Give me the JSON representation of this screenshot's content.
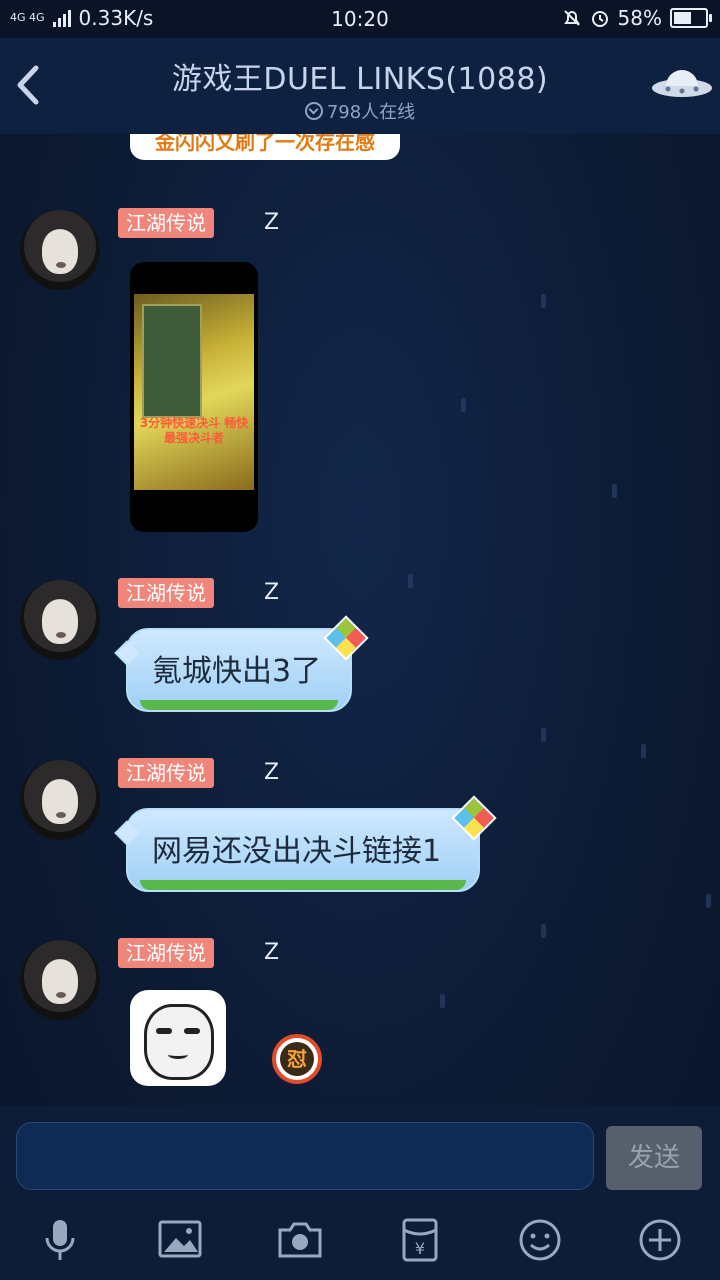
{
  "status_bar": {
    "network_tag": "4G 4G",
    "speed": "0.33K/s",
    "time": "10:20",
    "battery": "58%",
    "battery_level": 0.58,
    "icons": [
      "signal-icon",
      "mute-bell-icon",
      "alarm-icon",
      "battery-icon"
    ]
  },
  "header": {
    "title": "游戏王DUEL LINKS(1088)",
    "online": "798人在线",
    "icons": [
      "back-arrow-icon",
      "ufo-icon",
      "online-check-icon"
    ]
  },
  "chat": {
    "partial_message": "金闪闪又刷了一次存在感",
    "messages": [
      {
        "badge": "江湖传说",
        "name": "Z",
        "type": "image",
        "image_text": "3分钟快速决斗 畅快最强决斗者"
      },
      {
        "badge": "江湖传说",
        "name": "Z",
        "type": "text",
        "text": "氪城快出3了"
      },
      {
        "badge": "江湖传说",
        "name": "Z",
        "type": "text",
        "text": "网易还没出决斗链接1"
      },
      {
        "badge": "江湖传说",
        "name": "Z",
        "type": "sticker",
        "emoji_text": "怼"
      }
    ]
  },
  "input": {
    "placeholder": "",
    "send_label": "发送"
  },
  "toolbar": {
    "items": [
      "microphone-icon",
      "image-icon",
      "camera-icon",
      "red-packet-icon",
      "emoji-icon",
      "plus-icon"
    ]
  },
  "colors": {
    "background": "#0c1a33",
    "badge": "#f0857a",
    "bubble": "#aad8f7",
    "send_button": "#565f6b"
  }
}
